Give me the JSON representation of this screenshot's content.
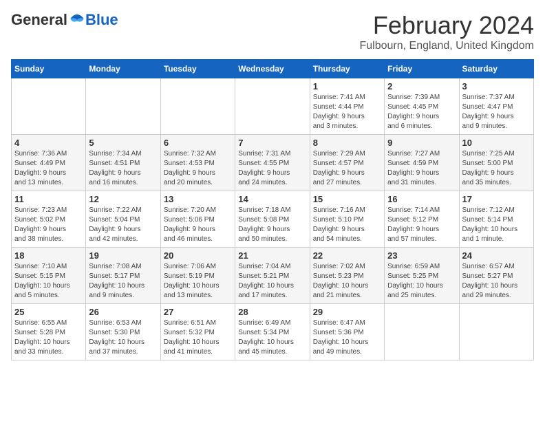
{
  "logo": {
    "general": "General",
    "blue": "Blue"
  },
  "title": {
    "month": "February 2024",
    "location": "Fulbourn, England, United Kingdom"
  },
  "calendar": {
    "headers": [
      "Sunday",
      "Monday",
      "Tuesday",
      "Wednesday",
      "Thursday",
      "Friday",
      "Saturday"
    ],
    "weeks": [
      [
        {
          "day": "",
          "info": ""
        },
        {
          "day": "",
          "info": ""
        },
        {
          "day": "",
          "info": ""
        },
        {
          "day": "",
          "info": ""
        },
        {
          "day": "1",
          "info": "Sunrise: 7:41 AM\nSunset: 4:44 PM\nDaylight: 9 hours\nand 3 minutes."
        },
        {
          "day": "2",
          "info": "Sunrise: 7:39 AM\nSunset: 4:45 PM\nDaylight: 9 hours\nand 6 minutes."
        },
        {
          "day": "3",
          "info": "Sunrise: 7:37 AM\nSunset: 4:47 PM\nDaylight: 9 hours\nand 9 minutes."
        }
      ],
      [
        {
          "day": "4",
          "info": "Sunrise: 7:36 AM\nSunset: 4:49 PM\nDaylight: 9 hours\nand 13 minutes."
        },
        {
          "day": "5",
          "info": "Sunrise: 7:34 AM\nSunset: 4:51 PM\nDaylight: 9 hours\nand 16 minutes."
        },
        {
          "day": "6",
          "info": "Sunrise: 7:32 AM\nSunset: 4:53 PM\nDaylight: 9 hours\nand 20 minutes."
        },
        {
          "day": "7",
          "info": "Sunrise: 7:31 AM\nSunset: 4:55 PM\nDaylight: 9 hours\nand 24 minutes."
        },
        {
          "day": "8",
          "info": "Sunrise: 7:29 AM\nSunset: 4:57 PM\nDaylight: 9 hours\nand 27 minutes."
        },
        {
          "day": "9",
          "info": "Sunrise: 7:27 AM\nSunset: 4:59 PM\nDaylight: 9 hours\nand 31 minutes."
        },
        {
          "day": "10",
          "info": "Sunrise: 7:25 AM\nSunset: 5:00 PM\nDaylight: 9 hours\nand 35 minutes."
        }
      ],
      [
        {
          "day": "11",
          "info": "Sunrise: 7:23 AM\nSunset: 5:02 PM\nDaylight: 9 hours\nand 38 minutes."
        },
        {
          "day": "12",
          "info": "Sunrise: 7:22 AM\nSunset: 5:04 PM\nDaylight: 9 hours\nand 42 minutes."
        },
        {
          "day": "13",
          "info": "Sunrise: 7:20 AM\nSunset: 5:06 PM\nDaylight: 9 hours\nand 46 minutes."
        },
        {
          "day": "14",
          "info": "Sunrise: 7:18 AM\nSunset: 5:08 PM\nDaylight: 9 hours\nand 50 minutes."
        },
        {
          "day": "15",
          "info": "Sunrise: 7:16 AM\nSunset: 5:10 PM\nDaylight: 9 hours\nand 54 minutes."
        },
        {
          "day": "16",
          "info": "Sunrise: 7:14 AM\nSunset: 5:12 PM\nDaylight: 9 hours\nand 57 minutes."
        },
        {
          "day": "17",
          "info": "Sunrise: 7:12 AM\nSunset: 5:14 PM\nDaylight: 10 hours\nand 1 minute."
        }
      ],
      [
        {
          "day": "18",
          "info": "Sunrise: 7:10 AM\nSunset: 5:15 PM\nDaylight: 10 hours\nand 5 minutes."
        },
        {
          "day": "19",
          "info": "Sunrise: 7:08 AM\nSunset: 5:17 PM\nDaylight: 10 hours\nand 9 minutes."
        },
        {
          "day": "20",
          "info": "Sunrise: 7:06 AM\nSunset: 5:19 PM\nDaylight: 10 hours\nand 13 minutes."
        },
        {
          "day": "21",
          "info": "Sunrise: 7:04 AM\nSunset: 5:21 PM\nDaylight: 10 hours\nand 17 minutes."
        },
        {
          "day": "22",
          "info": "Sunrise: 7:02 AM\nSunset: 5:23 PM\nDaylight: 10 hours\nand 21 minutes."
        },
        {
          "day": "23",
          "info": "Sunrise: 6:59 AM\nSunset: 5:25 PM\nDaylight: 10 hours\nand 25 minutes."
        },
        {
          "day": "24",
          "info": "Sunrise: 6:57 AM\nSunset: 5:27 PM\nDaylight: 10 hours\nand 29 minutes."
        }
      ],
      [
        {
          "day": "25",
          "info": "Sunrise: 6:55 AM\nSunset: 5:28 PM\nDaylight: 10 hours\nand 33 minutes."
        },
        {
          "day": "26",
          "info": "Sunrise: 6:53 AM\nSunset: 5:30 PM\nDaylight: 10 hours\nand 37 minutes."
        },
        {
          "day": "27",
          "info": "Sunrise: 6:51 AM\nSunset: 5:32 PM\nDaylight: 10 hours\nand 41 minutes."
        },
        {
          "day": "28",
          "info": "Sunrise: 6:49 AM\nSunset: 5:34 PM\nDaylight: 10 hours\nand 45 minutes."
        },
        {
          "day": "29",
          "info": "Sunrise: 6:47 AM\nSunset: 5:36 PM\nDaylight: 10 hours\nand 49 minutes."
        },
        {
          "day": "",
          "info": ""
        },
        {
          "day": "",
          "info": ""
        }
      ]
    ]
  }
}
